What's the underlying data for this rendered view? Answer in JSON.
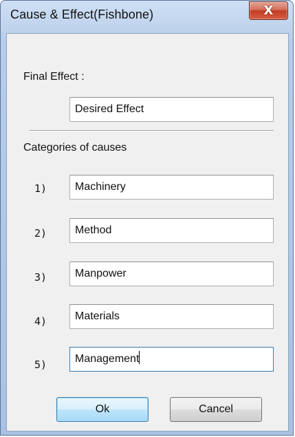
{
  "window": {
    "title": "Cause & Effect(Fishbone)",
    "close_glyph": "X"
  },
  "final_effect": {
    "label": "Final Effect :",
    "value": "Desired Effect"
  },
  "categories": {
    "heading": "Categories of causes",
    "items": [
      {
        "number": "1)",
        "value": "Machinery"
      },
      {
        "number": "2)",
        "value": "Method"
      },
      {
        "number": "3)",
        "value": "Manpower"
      },
      {
        "number": "4)",
        "value": "Materials"
      },
      {
        "number": "5)",
        "value": "Management"
      }
    ]
  },
  "buttons": {
    "ok_label": "Ok",
    "cancel_label": "Cancel"
  },
  "colors": {
    "close_button": "#c33d24",
    "default_button_border": "#3c7fb1"
  }
}
